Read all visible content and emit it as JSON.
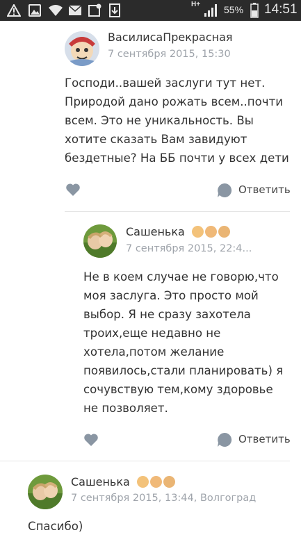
{
  "status_bar": {
    "battery_percent": "55%",
    "time": "14:51",
    "network": "H+",
    "icons": [
      "warning-icon",
      "image-icon",
      "wifi-icon",
      "mail-icon",
      "notification-icon",
      "download-icon"
    ]
  },
  "comments": [
    {
      "username": "ВасилисаПрекрасная",
      "date": "7 сентября 2015, 15:30",
      "text": "Господи..вашей заслуги тут нет.\nПриродой дано рожать всем..почти\nвсем. Это не уникальность. Вы\nхотите сказать Вам завидуют\nбездетные? На ББ почти у всех дети",
      "reply_label": "Ответить"
    },
    {
      "username": "Сашенька",
      "date": "7 сентября 2015, 22:4...",
      "text": "Не в коем случае не говорю,что\nмоя заслуга. Это просто мой\nвыбор. Я не сразу захотела\nтроих,еще недавно не\nхотела,потом желание\nпоявилось,стали планировать) я\nсочувствую тем,кому здоровье\nне позволяет.",
      "reply_label": "Ответить"
    },
    {
      "username": "Сашенька",
      "date": "7 сентября 2015, 13:44, Волгоград",
      "text": "Спасибо)"
    }
  ],
  "colors": {
    "status_bar": "#2b2b2b",
    "action_icon": "#8a96a3",
    "date_text": "#9fa4ab",
    "divider": "#e4e4e4"
  }
}
